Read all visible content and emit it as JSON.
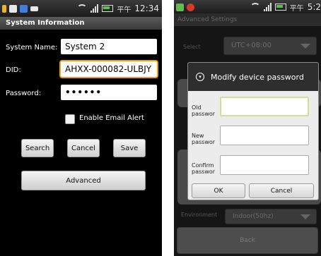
{
  "left_screen": {
    "status_bar": {
      "time": "12:34",
      "carrier_glyph": "平午",
      "icon_colors": [
        "#f0b418",
        "#e8e8e8",
        "#3f7fe0",
        "#e8e8e8"
      ]
    },
    "title": "System Information",
    "system_name": {
      "label": "System Name:",
      "value": "System 2"
    },
    "did": {
      "label": "DID:",
      "value": "AHXX-000082-ULBJY"
    },
    "password": {
      "label": "Password:",
      "value": "••••••"
    },
    "email_alert": {
      "label": "Enable Email Alert",
      "checked": false
    },
    "buttons": {
      "search": "Search",
      "cancel": "Cancel",
      "save": "Save",
      "advanced": "Advanced"
    }
  },
  "right_screen": {
    "status_bar": {
      "time": "5:2",
      "carrier_glyph": "平午"
    },
    "title": "Advanced Settings",
    "select": {
      "label": "Select",
      "value": "UTC+08:00"
    },
    "environment": {
      "label": "Environment",
      "value": "Indoor(50hz)"
    },
    "back_label": "Back",
    "dialog": {
      "title": "Modify device password",
      "old_label": "Old passwor",
      "new_label": "New passwor",
      "confirm_label": "Confirm passwor",
      "ok_label": "OK",
      "cancel_label": "Cancel"
    }
  },
  "colors": {
    "focus_orange": "#f29a1b",
    "dialog_focus": "#cfe09a",
    "battery_green": "#5cc04a"
  }
}
